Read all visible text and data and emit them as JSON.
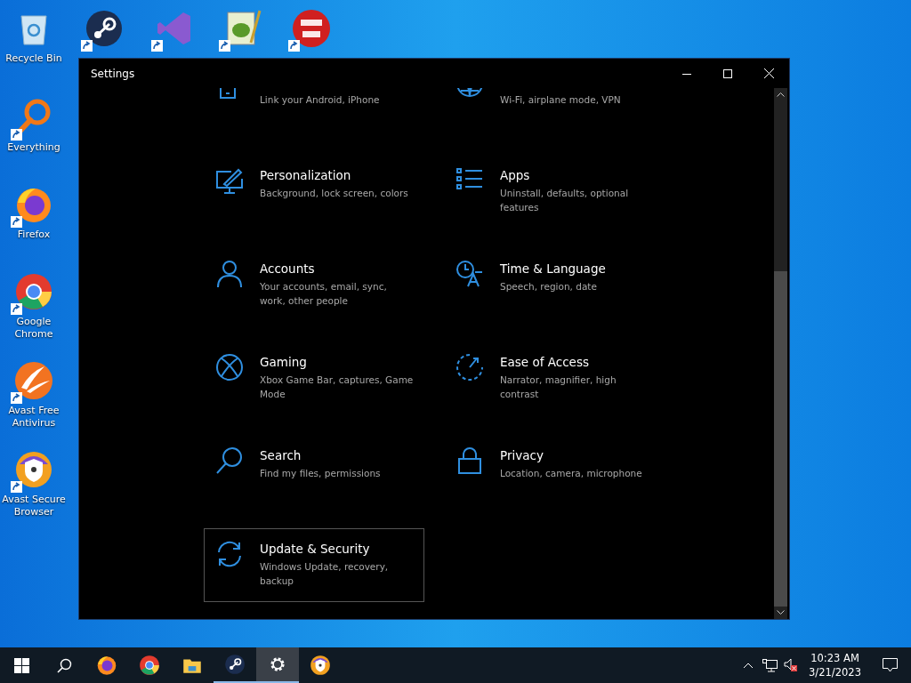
{
  "desktop_icons": [
    {
      "kind": "recycle",
      "label": "Recycle Bin",
      "shortcut": false
    },
    {
      "kind": "steam",
      "shortcut": true
    },
    {
      "kind": "visual-studio",
      "shortcut": true
    },
    {
      "kind": "notepad",
      "shortcut": true
    },
    {
      "kind": "devcpp",
      "shortcut": true
    },
    {
      "kind": "everything",
      "label": "Everything",
      "shortcut": true
    },
    {
      "kind": "firefox",
      "label": "Firefox",
      "shortcut": true
    },
    {
      "kind": "chrome",
      "label": "Google Chrome",
      "shortcut": true
    },
    {
      "kind": "avast",
      "label": "Avast Free Antivirus",
      "shortcut": true
    },
    {
      "kind": "avast-browser",
      "label": "Avast Secure Browser",
      "shortcut": true
    }
  ],
  "window": {
    "title": "Settings"
  },
  "tiles": [
    {
      "kind": "phone",
      "description": "Link your Android, iPhone",
      "focused": false
    },
    {
      "kind": "globe",
      "description": "Wi-Fi, airplane mode, VPN",
      "focused": false
    },
    {
      "kind": "brush",
      "title": "Personalization",
      "description": "Background, lock screen, colors",
      "focused": false
    },
    {
      "kind": "apps",
      "title": "Apps",
      "description": "Uninstall, defaults, optional features",
      "focused": false
    },
    {
      "kind": "person",
      "title": "Accounts",
      "description": "Your accounts, email, sync, work, other people",
      "focused": false
    },
    {
      "kind": "time",
      "title": "Time & Language",
      "description": "Speech, region, date",
      "focused": false
    },
    {
      "kind": "xbox",
      "title": "Gaming",
      "description": "Xbox Game Bar, captures, Game Mode",
      "focused": false
    },
    {
      "kind": "ease",
      "title": "Ease of Access",
      "description": "Narrator, magnifier, high contrast",
      "focused": false
    },
    {
      "kind": "search",
      "title": "Search",
      "description": "Find my files, permissions",
      "focused": false
    },
    {
      "kind": "lock",
      "title": "Privacy",
      "description": "Location, camera, microphone",
      "focused": false
    },
    {
      "kind": "sync",
      "title": "Update & Security",
      "description": "Windows Update, recovery, backup",
      "focused": true
    }
  ],
  "taskbar": {
    "apps": [
      {
        "kind": "firefox",
        "active": false,
        "running": false
      },
      {
        "kind": "chrome",
        "active": false,
        "running": false
      },
      {
        "kind": "explorer",
        "active": false,
        "running": false
      },
      {
        "kind": "steam",
        "active": false,
        "running": true
      },
      {
        "kind": "settings",
        "active": true,
        "running": true
      },
      {
        "kind": "avast-browser",
        "active": false,
        "running": false
      }
    ],
    "time": "10:23 AM",
    "date": "3/21/2023"
  }
}
